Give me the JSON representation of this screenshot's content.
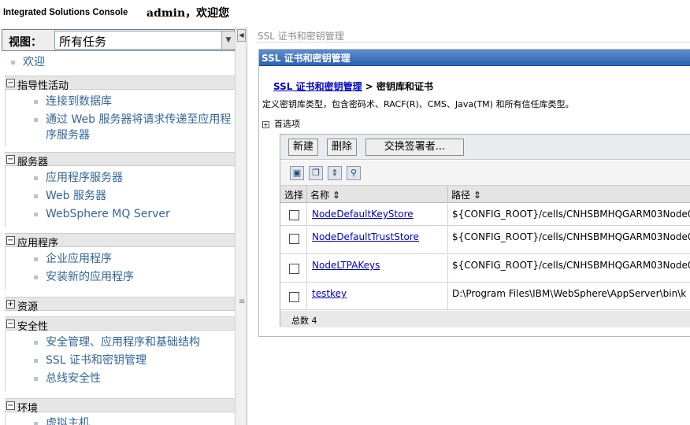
{
  "header": {
    "app_title": "Integrated Solutions Console",
    "welcome": "admin，欢迎您"
  },
  "nav": {
    "view_label": "视图：",
    "view_selected": "所有任务",
    "welcome_link": "欢迎",
    "sections": [
      {
        "title": "指导性活动",
        "toggle": "−",
        "items": [
          "连接到数据库",
          "通过 Web 服务器将请求传递至应用程序服务器"
        ]
      },
      {
        "title": "服务器",
        "toggle": "−",
        "items": [
          "应用程序服务器",
          "Web 服务器",
          "WebSphere MQ Server"
        ]
      },
      {
        "title": "应用程序",
        "toggle": "−",
        "items": [
          "企业应用程序",
          "安装新的应用程序"
        ]
      },
      {
        "title": "资源",
        "toggle": "+",
        "items": []
      },
      {
        "title": "安全性",
        "toggle": "−",
        "items": [
          "安全管理、应用程序和基础结构",
          "SSL 证书和密钥管理",
          "总线安全性"
        ]
      },
      {
        "title": "环境",
        "toggle": "−",
        "items": [
          "虚拟主机"
        ]
      }
    ]
  },
  "content": {
    "breadcrumb_top": "SSL 证书和密钥管理",
    "portlet_title": "SSL 证书和密钥管理",
    "crumb_link": "SSL 证书和密钥管理",
    "crumb_sep": ">",
    "crumb_current": "密钥库和证书",
    "description": "定义密钥库类型，包含密码术、RACF(R)、CMS、Java(TM) 和所有信任库类型。",
    "preferences": "首选项",
    "buttons": {
      "new": "新建",
      "delete": "删除",
      "exchange": "交换签署者..."
    },
    "columns": {
      "select": "选择",
      "name": "名称",
      "path": "路径"
    },
    "rows": [
      {
        "name": "NodeDefaultKeyStore",
        "path": "${CONFIG_ROOT}/cells/CNHSBMHQGARM03Node0"
      },
      {
        "name": "NodeDefaultTrustStore",
        "path": "${CONFIG_ROOT}/cells/CNHSBMHQGARM03Node0"
      },
      {
        "name": "NodeLTPAKeys",
        "path": "${CONFIG_ROOT}/cells/CNHSBMHQGARM03Node0"
      },
      {
        "name": "testkey",
        "path": "D:\\Program Files\\IBM\\WebSphere\\AppServer\\bin\\k"
      }
    ],
    "total": "总数 4"
  }
}
